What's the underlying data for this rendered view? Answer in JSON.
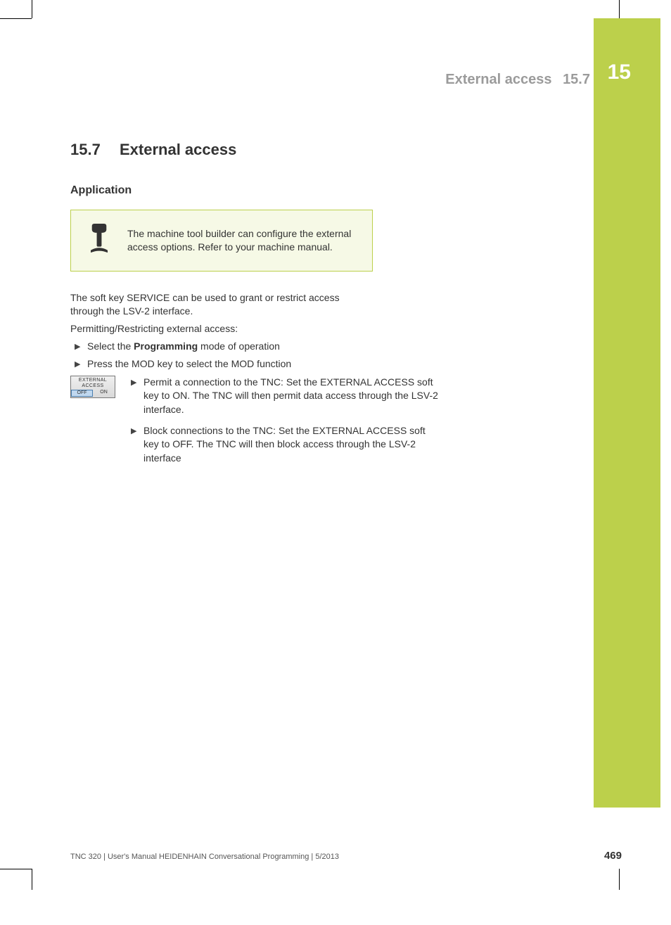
{
  "chapter_tab": "15",
  "running_head": {
    "title": "External access",
    "num": "15.7"
  },
  "section": {
    "num": "15.7",
    "title": "External access"
  },
  "sub": "Application",
  "note": "The machine tool builder can configure the external access options. Refer to your machine manual.",
  "p1": "The soft key SERVICE can be used to grant or restrict access through the LSV-2 interface.",
  "p2": "Permitting/Restricting external access:",
  "b1_pre": "Select the ",
  "b1_bold": "Programming",
  "b1_post": " mode of operation",
  "b2": "Press the MOD key to select the MOD function",
  "softkey": {
    "l1": "EXTERNAL",
    "l2": "ACCESS",
    "off": "OFF",
    "on": "ON"
  },
  "sb1": "Permit a connection to the TNC: Set the EXTERNAL ACCESS soft key to ON. The TNC will then permit data access through the LSV-2 interface.",
  "sb2": "Block connections to the TNC: Set the EXTERNAL ACCESS soft key to OFF. The TNC will then block access through the LSV-2 interface",
  "footer": {
    "text": "TNC 320 | User's Manual HEIDENHAIN Conversational Programming | 5/2013",
    "page": "469"
  }
}
